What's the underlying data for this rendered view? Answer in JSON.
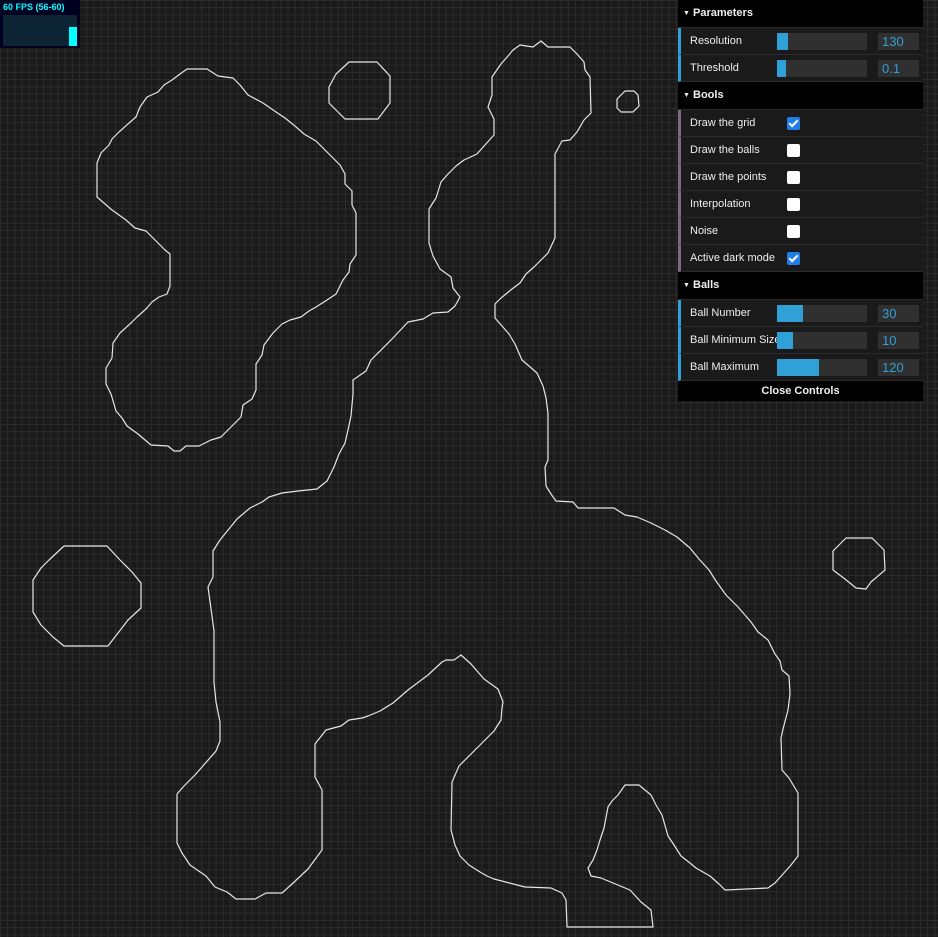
{
  "stats": {
    "fps_text": "60 FPS (56-60)",
    "fps_level": 0.6
  },
  "gui": {
    "folders": {
      "parameters": {
        "title": "Parameters"
      },
      "bools": {
        "title": "Bools"
      },
      "balls": {
        "title": "Balls"
      }
    },
    "parameters": [
      {
        "label": "Resolution",
        "value": "130",
        "fill": 0.12
      },
      {
        "label": "Threshold",
        "value": "0.1",
        "fill": 0.1
      }
    ],
    "bools": [
      {
        "label": "Draw the grid",
        "checked": true
      },
      {
        "label": "Draw the balls",
        "checked": false
      },
      {
        "label": "Draw the points",
        "checked": false
      },
      {
        "label": "Interpolation",
        "checked": false
      },
      {
        "label": "Noise",
        "checked": false
      },
      {
        "label": "Active dark mode",
        "checked": true
      }
    ],
    "balls": [
      {
        "label": "Ball Number",
        "value": "30",
        "fill": 0.29
      },
      {
        "label": "Ball Minimum Size",
        "value": "10",
        "fill": 0.18
      },
      {
        "label": "Ball Maximum",
        "value": "120",
        "fill": 0.47
      }
    ],
    "close_label": "Close Controls"
  },
  "colors": {
    "accent": "#2fa1d6",
    "bool_accent": "#806787",
    "fps": "#00ffff",
    "contour": "#e6e6e6",
    "background": "#1a1a1a"
  }
}
